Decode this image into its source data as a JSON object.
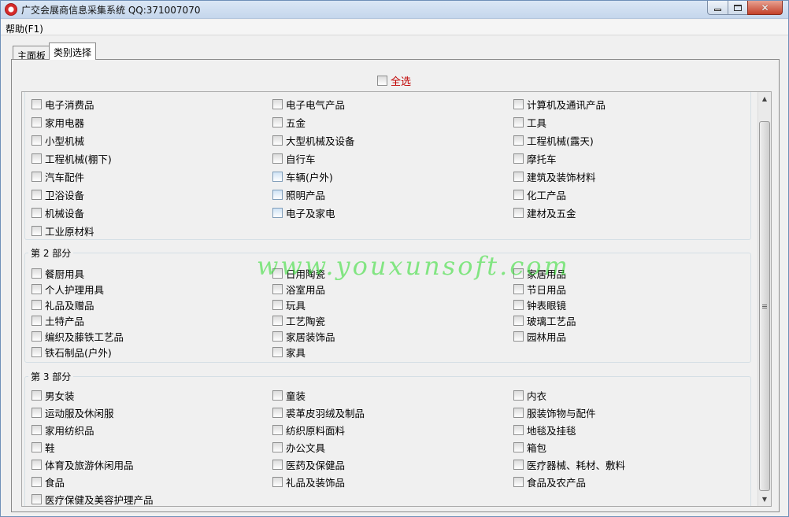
{
  "window": {
    "title": "广交会展商信息采集系统 QQ:371007070"
  },
  "menu": {
    "help": "帮助(F1)"
  },
  "tabs": [
    {
      "label": "主面板"
    },
    {
      "label": "类别选择"
    }
  ],
  "select_all": "全选",
  "watermark": "www.youxunsoft.com",
  "groups": [
    {
      "legend": "",
      "columns": [
        [
          "电子消费品",
          "家用电器",
          "小型机械",
          "工程机械(棚下)",
          "汽车配件",
          "卫浴设备",
          "机械设备",
          "工业原材料"
        ],
        [
          "电子电气产品",
          "五金",
          "大型机械及设备",
          "自行车",
          "车辆(户外)",
          "照明产品",
          "电子及家电"
        ],
        [
          "计算机及通讯产品",
          "工具",
          "工程机械(露天)",
          "摩托车",
          "建筑及装饰材料",
          "化工产品",
          "建材及五金"
        ]
      ]
    },
    {
      "legend": "第 2 部分",
      "columns": [
        [
          "餐厨用具",
          "个人护理用具",
          "礼品及赠品",
          "土特产品",
          "编织及藤铁工艺品",
          "铁石制品(户外)"
        ],
        [
          "日用陶瓷",
          "浴室用品",
          "玩具",
          "工艺陶瓷",
          "家居装饰品",
          "家具"
        ],
        [
          "家居用品",
          "节日用品",
          "钟表眼镜",
          "玻璃工艺品",
          "园林用品"
        ]
      ]
    },
    {
      "legend": "第 3 部分",
      "columns": [
        [
          "男女装",
          "运动服及休闲服",
          "家用纺织品",
          "鞋",
          "体育及旅游休闲用品",
          "食品",
          "医疗保健及美容护理产品"
        ],
        [
          "童装",
          "裘革皮羽绒及制品",
          "纺织原料面料",
          "办公文具",
          "医药及保健品",
          "礼品及装饰品"
        ],
        [
          "内衣",
          "服装饰物与配件",
          "地毯及挂毯",
          "箱包",
          "医疗器械、耗材、敷料",
          "食品及农产品"
        ]
      ]
    }
  ]
}
